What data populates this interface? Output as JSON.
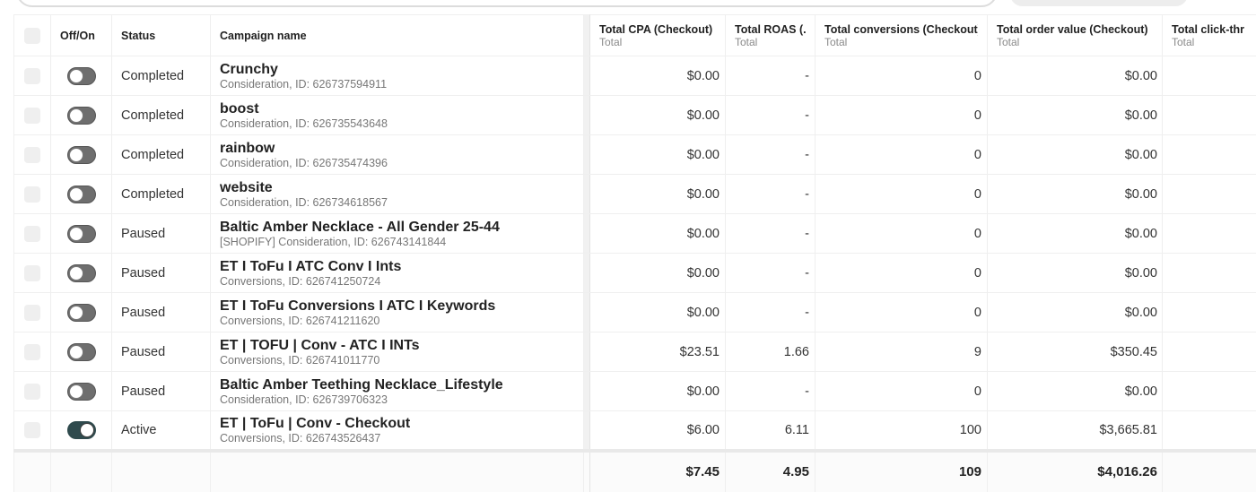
{
  "columns": {
    "toggle": "Off/On",
    "status": "Status",
    "name": "Campaign name",
    "cpa": {
      "title": "Total CPA (Checkout)",
      "sub": "Total"
    },
    "roas": {
      "title": "Total ROAS (...",
      "sub": "Total"
    },
    "conv": {
      "title": "Total conversions (Checkout)",
      "sub": "Total"
    },
    "order": {
      "title": "Total order value (Checkout)",
      "sub": "Total"
    },
    "ctr": {
      "title": "Total click-thr",
      "sub": "Total"
    }
  },
  "rows": [
    {
      "on": false,
      "status": "Completed",
      "name": "Crunchy",
      "meta": "Consideration, ID: 626737594911",
      "cpa": "$0.00",
      "roas": "-",
      "conv": "0",
      "order": "$0.00",
      "ctr": ""
    },
    {
      "on": false,
      "status": "Completed",
      "name": "boost",
      "meta": "Consideration, ID: 626735543648",
      "cpa": "$0.00",
      "roas": "-",
      "conv": "0",
      "order": "$0.00",
      "ctr": ""
    },
    {
      "on": false,
      "status": "Completed",
      "name": "rainbow",
      "meta": "Consideration, ID: 626735474396",
      "cpa": "$0.00",
      "roas": "-",
      "conv": "0",
      "order": "$0.00",
      "ctr": ""
    },
    {
      "on": false,
      "status": "Completed",
      "name": "website",
      "meta": "Consideration, ID: 626734618567",
      "cpa": "$0.00",
      "roas": "-",
      "conv": "0",
      "order": "$0.00",
      "ctr": ""
    },
    {
      "on": false,
      "status": "Paused",
      "name": "Baltic Amber Necklace - All Gender 25-44",
      "meta": "[SHOPIFY] Consideration, ID: 626743141844",
      "cpa": "$0.00",
      "roas": "-",
      "conv": "0",
      "order": "$0.00",
      "ctr": ""
    },
    {
      "on": false,
      "status": "Paused",
      "name": "ET I ToFu I ATC Conv I Ints",
      "meta": "Conversions, ID: 626741250724",
      "cpa": "$0.00",
      "roas": "-",
      "conv": "0",
      "order": "$0.00",
      "ctr": ""
    },
    {
      "on": false,
      "status": "Paused",
      "name": "ET I ToFu Conversions I ATC I Keywords",
      "meta": "Conversions, ID: 626741211620",
      "cpa": "$0.00",
      "roas": "-",
      "conv": "0",
      "order": "$0.00",
      "ctr": ""
    },
    {
      "on": false,
      "status": "Paused",
      "name": "ET | TOFU | Conv - ATC I INTs",
      "meta": "Conversions, ID: 626741011770",
      "cpa": "$23.51",
      "roas": "1.66",
      "conv": "9",
      "order": "$350.45",
      "ctr": ""
    },
    {
      "on": false,
      "status": "Paused",
      "name": "Baltic Amber Teething Necklace_Lifestyle",
      "meta": "Consideration, ID: 626739706323",
      "cpa": "$0.00",
      "roas": "-",
      "conv": "0",
      "order": "$0.00",
      "ctr": ""
    },
    {
      "on": true,
      "status": "Active",
      "name": "ET | ToFu | Conv - Checkout",
      "meta": "Conversions, ID: 626743526437",
      "cpa": "$6.00",
      "roas": "6.11",
      "conv": "100",
      "order": "$3,665.81",
      "ctr": ""
    }
  ],
  "totals": {
    "cpa": "$7.45",
    "roas": "4.95",
    "conv": "109",
    "order": "$4,016.26",
    "ctr": ""
  }
}
